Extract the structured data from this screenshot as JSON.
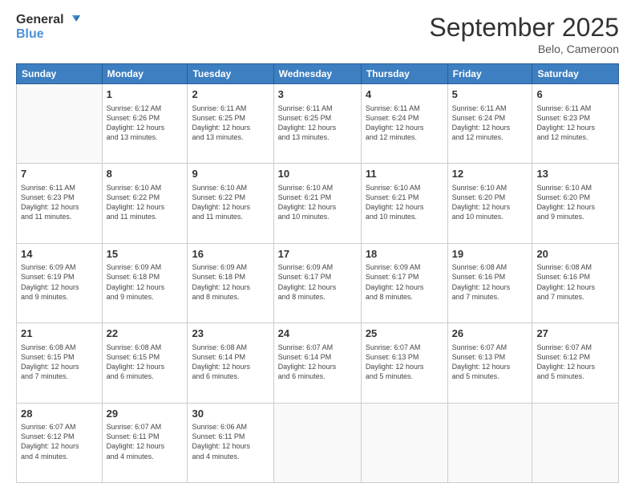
{
  "logo": {
    "line1": "General",
    "line2": "Blue"
  },
  "title": "September 2025",
  "location": "Belo, Cameroon",
  "days_header": [
    "Sunday",
    "Monday",
    "Tuesday",
    "Wednesday",
    "Thursday",
    "Friday",
    "Saturday"
  ],
  "weeks": [
    [
      {
        "day": "",
        "info": ""
      },
      {
        "day": "1",
        "info": "Sunrise: 6:12 AM\nSunset: 6:26 PM\nDaylight: 12 hours\nand 13 minutes."
      },
      {
        "day": "2",
        "info": "Sunrise: 6:11 AM\nSunset: 6:25 PM\nDaylight: 12 hours\nand 13 minutes."
      },
      {
        "day": "3",
        "info": "Sunrise: 6:11 AM\nSunset: 6:25 PM\nDaylight: 12 hours\nand 13 minutes."
      },
      {
        "day": "4",
        "info": "Sunrise: 6:11 AM\nSunset: 6:24 PM\nDaylight: 12 hours\nand 12 minutes."
      },
      {
        "day": "5",
        "info": "Sunrise: 6:11 AM\nSunset: 6:24 PM\nDaylight: 12 hours\nand 12 minutes."
      },
      {
        "day": "6",
        "info": "Sunrise: 6:11 AM\nSunset: 6:23 PM\nDaylight: 12 hours\nand 12 minutes."
      }
    ],
    [
      {
        "day": "7",
        "info": "Sunrise: 6:11 AM\nSunset: 6:23 PM\nDaylight: 12 hours\nand 11 minutes."
      },
      {
        "day": "8",
        "info": "Sunrise: 6:10 AM\nSunset: 6:22 PM\nDaylight: 12 hours\nand 11 minutes."
      },
      {
        "day": "9",
        "info": "Sunrise: 6:10 AM\nSunset: 6:22 PM\nDaylight: 12 hours\nand 11 minutes."
      },
      {
        "day": "10",
        "info": "Sunrise: 6:10 AM\nSunset: 6:21 PM\nDaylight: 12 hours\nand 10 minutes."
      },
      {
        "day": "11",
        "info": "Sunrise: 6:10 AM\nSunset: 6:21 PM\nDaylight: 12 hours\nand 10 minutes."
      },
      {
        "day": "12",
        "info": "Sunrise: 6:10 AM\nSunset: 6:20 PM\nDaylight: 12 hours\nand 10 minutes."
      },
      {
        "day": "13",
        "info": "Sunrise: 6:10 AM\nSunset: 6:20 PM\nDaylight: 12 hours\nand 9 minutes."
      }
    ],
    [
      {
        "day": "14",
        "info": "Sunrise: 6:09 AM\nSunset: 6:19 PM\nDaylight: 12 hours\nand 9 minutes."
      },
      {
        "day": "15",
        "info": "Sunrise: 6:09 AM\nSunset: 6:18 PM\nDaylight: 12 hours\nand 9 minutes."
      },
      {
        "day": "16",
        "info": "Sunrise: 6:09 AM\nSunset: 6:18 PM\nDaylight: 12 hours\nand 8 minutes."
      },
      {
        "day": "17",
        "info": "Sunrise: 6:09 AM\nSunset: 6:17 PM\nDaylight: 12 hours\nand 8 minutes."
      },
      {
        "day": "18",
        "info": "Sunrise: 6:09 AM\nSunset: 6:17 PM\nDaylight: 12 hours\nand 8 minutes."
      },
      {
        "day": "19",
        "info": "Sunrise: 6:08 AM\nSunset: 6:16 PM\nDaylight: 12 hours\nand 7 minutes."
      },
      {
        "day": "20",
        "info": "Sunrise: 6:08 AM\nSunset: 6:16 PM\nDaylight: 12 hours\nand 7 minutes."
      }
    ],
    [
      {
        "day": "21",
        "info": "Sunrise: 6:08 AM\nSunset: 6:15 PM\nDaylight: 12 hours\nand 7 minutes."
      },
      {
        "day": "22",
        "info": "Sunrise: 6:08 AM\nSunset: 6:15 PM\nDaylight: 12 hours\nand 6 minutes."
      },
      {
        "day": "23",
        "info": "Sunrise: 6:08 AM\nSunset: 6:14 PM\nDaylight: 12 hours\nand 6 minutes."
      },
      {
        "day": "24",
        "info": "Sunrise: 6:07 AM\nSunset: 6:14 PM\nDaylight: 12 hours\nand 6 minutes."
      },
      {
        "day": "25",
        "info": "Sunrise: 6:07 AM\nSunset: 6:13 PM\nDaylight: 12 hours\nand 5 minutes."
      },
      {
        "day": "26",
        "info": "Sunrise: 6:07 AM\nSunset: 6:13 PM\nDaylight: 12 hours\nand 5 minutes."
      },
      {
        "day": "27",
        "info": "Sunrise: 6:07 AM\nSunset: 6:12 PM\nDaylight: 12 hours\nand 5 minutes."
      }
    ],
    [
      {
        "day": "28",
        "info": "Sunrise: 6:07 AM\nSunset: 6:12 PM\nDaylight: 12 hours\nand 4 minutes."
      },
      {
        "day": "29",
        "info": "Sunrise: 6:07 AM\nSunset: 6:11 PM\nDaylight: 12 hours\nand 4 minutes."
      },
      {
        "day": "30",
        "info": "Sunrise: 6:06 AM\nSunset: 6:11 PM\nDaylight: 12 hours\nand 4 minutes."
      },
      {
        "day": "",
        "info": ""
      },
      {
        "day": "",
        "info": ""
      },
      {
        "day": "",
        "info": ""
      },
      {
        "day": "",
        "info": ""
      }
    ]
  ]
}
